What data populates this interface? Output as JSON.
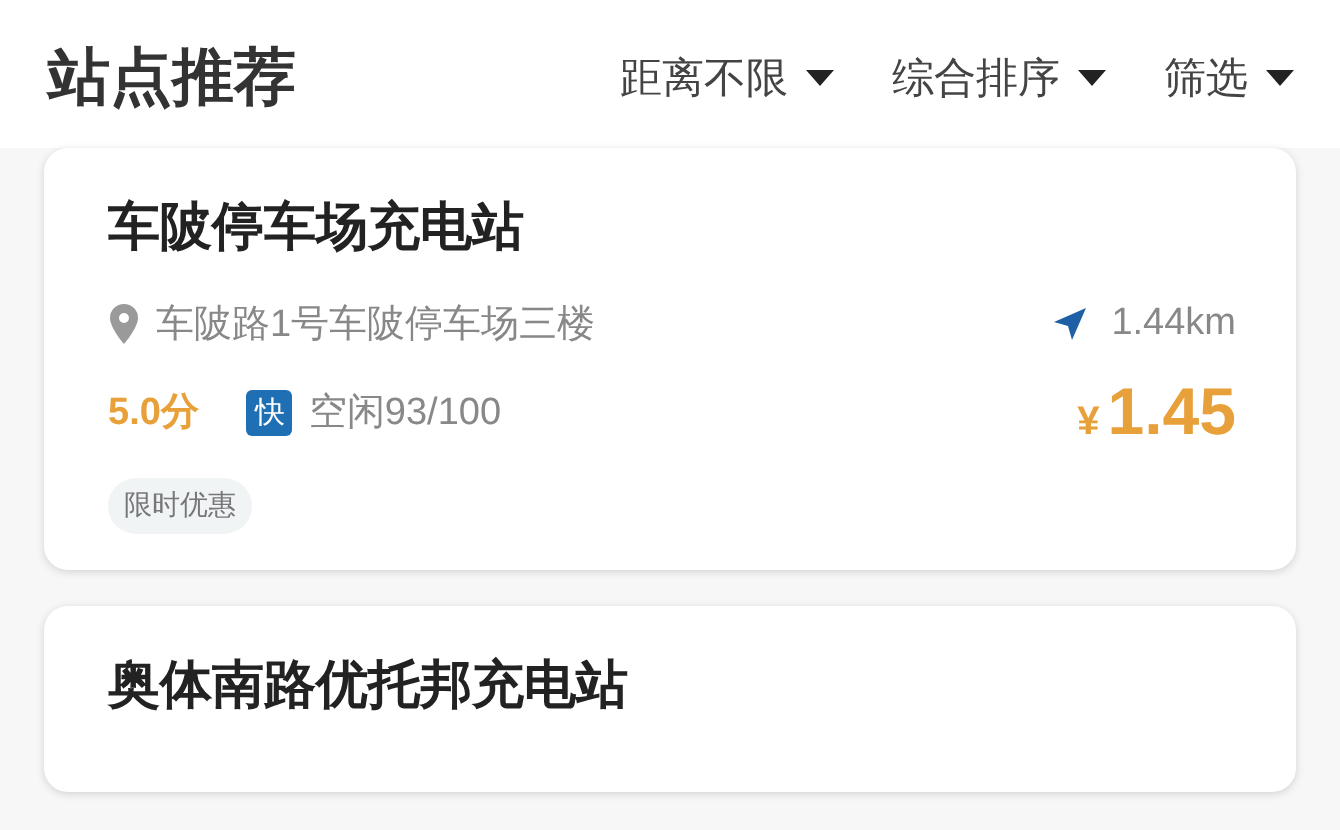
{
  "header": {
    "title": "站点推荐",
    "filters": [
      {
        "label": "距离不限"
      },
      {
        "label": "综合排序"
      },
      {
        "label": "筛选"
      }
    ]
  },
  "stations": [
    {
      "name": "车陂停车场充电站",
      "address": "车陂路1号车陂停车场三楼",
      "distance": "1.44km",
      "rating": "5.0分",
      "charge_type": "快",
      "availability": "空闲93/100",
      "currency": "¥",
      "price": "1.45",
      "tags": [
        "限时优惠"
      ]
    },
    {
      "name": "奥体南路优托邦充电站"
    }
  ]
}
